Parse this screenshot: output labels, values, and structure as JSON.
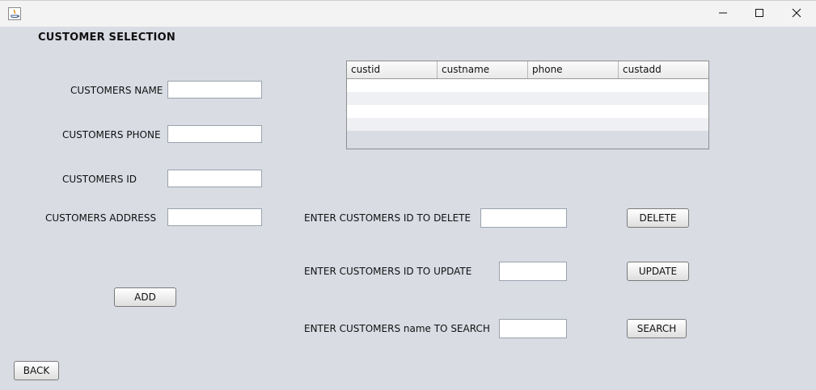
{
  "window": {
    "app_icon": "java-icon",
    "minimize_icon": "minimize-icon",
    "maximize_icon": "maximize-icon",
    "close_icon": "close-icon"
  },
  "header": {
    "title": "CUSTOMER SELECTION"
  },
  "form": {
    "name_label": "CUSTOMERS NAME",
    "name_value": "",
    "phone_label": "CUSTOMERS PHONE",
    "phone_value": "",
    "id_label": "CUSTOMERS ID",
    "id_value": "",
    "address_label": "CUSTOMERS ADDRESS",
    "address_value": "",
    "add_button": "ADD"
  },
  "table": {
    "columns": [
      "custid",
      "custname",
      "phone",
      "custadd"
    ],
    "rows": []
  },
  "actions": {
    "delete_label": "ENTER CUSTOMERS ID TO DELETE",
    "delete_value": "",
    "delete_button": "DELETE",
    "update_label": "ENTER CUSTOMERS ID TO UPDATE",
    "update_value": "",
    "update_button": "UPDATE",
    "search_label": "ENTER CUSTOMERS name TO SEARCH",
    "search_value": "",
    "search_button": "SEARCH"
  },
  "footer": {
    "back_button": "BACK"
  }
}
